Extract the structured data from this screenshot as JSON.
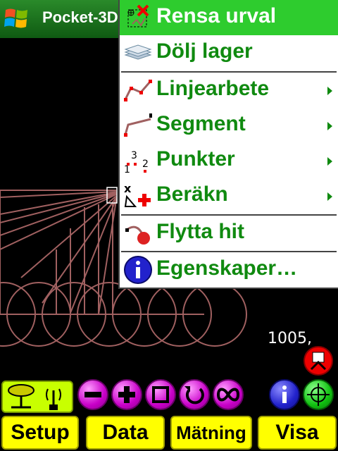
{
  "window": {
    "app_title": "Pocket-3D",
    "start_icon": "windows-logo-icon"
  },
  "canvas": {
    "coord_readout": "1005,",
    "line_color": "#a06060"
  },
  "context_menu": {
    "items": [
      {
        "label": "Rensa urval",
        "icon": "clear-selection-icon",
        "highlighted": true,
        "submenu": false
      },
      {
        "label": "Dölj lager",
        "icon": "layers-icon",
        "highlighted": false,
        "submenu": false
      },
      {
        "label": "Linjearbete",
        "icon": "polyline-icon",
        "highlighted": false,
        "submenu": true
      },
      {
        "label": "Segment",
        "icon": "segment-icon",
        "highlighted": false,
        "submenu": true
      },
      {
        "label": "Punkter",
        "icon": "points-icon",
        "highlighted": false,
        "submenu": true
      },
      {
        "label": "Beräkn",
        "icon": "calculate-icon",
        "highlighted": false,
        "submenu": true
      },
      {
        "label": "Flytta hit",
        "icon": "move-here-icon",
        "highlighted": false,
        "submenu": false
      },
      {
        "label": "Egenskaper…",
        "icon": "info-icon",
        "highlighted": false,
        "submenu": false
      }
    ],
    "highlight_color": "#2ecc2e",
    "text_color": "#108a10"
  },
  "toolbar": {
    "instrument_icon": "instrument-antenna-icon",
    "buttons": [
      {
        "icon": "zoom-out-icon"
      },
      {
        "icon": "zoom-in-icon"
      },
      {
        "icon": "zoom-window-icon"
      },
      {
        "icon": "refresh-icon"
      },
      {
        "icon": "zoom-all-icon"
      },
      {
        "icon": "info-icon"
      },
      {
        "icon": "gps-target-icon"
      }
    ],
    "alert_icon": "warning-person-icon"
  },
  "softkeys": {
    "setup": "Setup",
    "data": "Data",
    "matning": "Mätning",
    "visa": "Visa",
    "color": "#ffff00"
  }
}
